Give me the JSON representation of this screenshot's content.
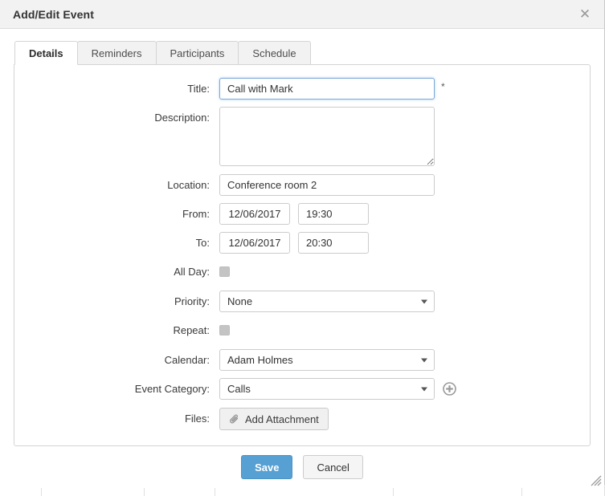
{
  "window": {
    "title": "Add/Edit Event",
    "close_label": "✕"
  },
  "tabs": [
    {
      "label": "Details",
      "active": true
    },
    {
      "label": "Reminders",
      "active": false
    },
    {
      "label": "Participants",
      "active": false
    },
    {
      "label": "Schedule",
      "active": false
    }
  ],
  "form": {
    "title": {
      "label": "Title:",
      "value": "Call with Mark",
      "required_marker": "*",
      "focused": true
    },
    "description": {
      "label": "Description:",
      "value": "",
      "placeholder": ""
    },
    "location": {
      "label": "Location:",
      "value": "Conference room 2"
    },
    "from": {
      "label": "From:",
      "date": "12/06/2017",
      "time": "19:30"
    },
    "to": {
      "label": "To:",
      "date": "12/06/2017",
      "time": "20:30"
    },
    "all_day": {
      "label": "All Day:",
      "checked": false
    },
    "priority": {
      "label": "Priority:",
      "value": "None"
    },
    "repeat": {
      "label": "Repeat:",
      "checked": false
    },
    "calendar": {
      "label": "Calendar:",
      "value": "Adam Holmes"
    },
    "event_category": {
      "label": "Event Category:",
      "value": "Calls",
      "add_icon": "add-circle-icon"
    },
    "files": {
      "label": "Files:",
      "button_label": "Add Attachment",
      "icon": "paperclip-icon"
    }
  },
  "footer": {
    "save_label": "Save",
    "cancel_label": "Cancel"
  },
  "colors": {
    "primary_button": "#56a0d3",
    "header_bg": "#f2f2f2",
    "focus_border": "#7ba7d7",
    "checkbox_fill": "#c4c4c4"
  }
}
